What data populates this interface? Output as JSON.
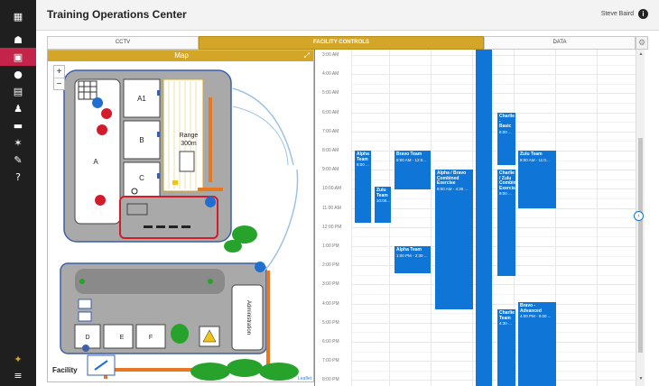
{
  "app": {
    "title": "Training Operations Center",
    "user_name": "Steve Baird"
  },
  "sidebar": {
    "items": [
      {
        "icon": "grid-icon",
        "glyph": "▦"
      },
      {
        "icon": "graduation-cap-icon",
        "glyph": "☗"
      },
      {
        "icon": "map-icon",
        "glyph": "▣"
      },
      {
        "icon": "palette-icon",
        "glyph": "●"
      },
      {
        "icon": "calendar-icon",
        "glyph": "▤"
      },
      {
        "icon": "person-icon",
        "glyph": "♟"
      },
      {
        "icon": "id-card-icon",
        "glyph": "▬"
      },
      {
        "icon": "runner-icon",
        "glyph": "✶"
      },
      {
        "icon": "wrench-icon",
        "glyph": "✎"
      },
      {
        "icon": "help-icon",
        "glyph": "?"
      },
      {
        "icon": "badge-icon",
        "glyph": "✦"
      },
      {
        "icon": "menu-icon",
        "glyph": "≡"
      }
    ]
  },
  "tabs": [
    {
      "label": "CCTV"
    },
    {
      "label": "FACILITY CONTROLS"
    },
    {
      "label": "DATA"
    }
  ],
  "map": {
    "title": "Map",
    "zoom_in": "+",
    "zoom_out": "−",
    "facility_label": "Facility",
    "attribution": "Leaflet",
    "labels": {
      "a1": "A1",
      "b": "B",
      "c": "C",
      "a": "A",
      "range_line1": "Range",
      "range_line2": "300m",
      "d": "D",
      "e": "E",
      "f": "F",
      "admin": "Administration"
    }
  },
  "calendar": {
    "times": [
      "3:00 AM",
      "4:00 AM",
      "5:00 AM",
      "6:00 AM",
      "7:00 AM",
      "8:00 AM",
      "9:00 AM",
      "10:00 AM",
      "11:00 AM",
      "12:00 PM",
      "1:00 PM",
      "2:00 PM",
      "3:00 PM",
      "4:00 PM",
      "5:00 PM",
      "6:00 PM",
      "7:00 PM",
      "8:00 PM"
    ],
    "events": [
      {
        "title": "Alpha Team",
        "time": "8:00 ..."
      },
      {
        "title": "Zulu Team",
        "time": "10:00..."
      },
      {
        "title": "Bravo Team",
        "time": "8:00 AM - 12:0..."
      },
      {
        "title": "Alpha Team",
        "time": "1:00 PM - 2:30 ..."
      },
      {
        "title": "Alpha / Bravo Combined Exercise",
        "time": "9:00 AM - 4:30 ..."
      },
      {
        "title": "Charlie - Basic",
        "time": "6:00 ..."
      },
      {
        "title": "Charlie / Zulu Combined Exercise",
        "time": "9:00 ..."
      },
      {
        "title": "Charlie Team",
        "time": "4:30 ..."
      },
      {
        "title": "Zulu Team",
        "time": "8:00 AM - 11:0..."
      },
      {
        "title": "Bravo - Advanced",
        "time": "4:00 PM - 9:00 ..."
      }
    ]
  },
  "colors": {
    "accent": "#d4a628",
    "event": "#0f75d6",
    "sidebar": "#1f1f1f",
    "active_sidebar": "#c4244a"
  }
}
